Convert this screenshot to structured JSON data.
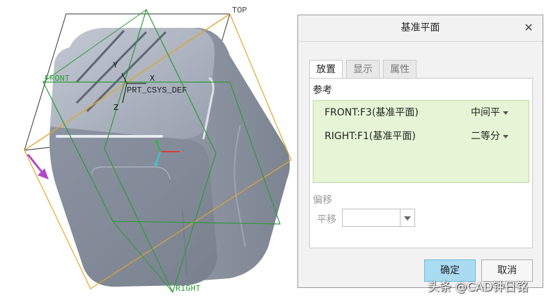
{
  "viewport": {
    "labels": {
      "top": "TOP",
      "front": "FRONT",
      "right": "RIGHT",
      "csys": "PRT_CSYS_DEF",
      "axis_x": "X",
      "axis_y": "Y",
      "axis_z": "Z"
    },
    "colors": {
      "plane_orange": "#e3a52b",
      "plane_green": "#2c9a35",
      "part_body": "#8e97a6",
      "arrow": "#b246c9"
    }
  },
  "dialog": {
    "title": "基准平面",
    "close_icon": "close-icon",
    "tabs": [
      "放置",
      "显示",
      "属性"
    ],
    "active_tab": "放置",
    "references_title": "参考",
    "references": [
      {
        "name": "FRONT:F3(基准平面)",
        "constraint": "中间平"
      },
      {
        "name": "RIGHT:F1(基准平面)",
        "constraint": "二等分"
      }
    ],
    "offset_title": "偏移",
    "offset_label": "平移",
    "offset_value": "",
    "ok_label": "确定",
    "cancel_label": "取消"
  },
  "watermark": "头条 @CAD钟日铭"
}
